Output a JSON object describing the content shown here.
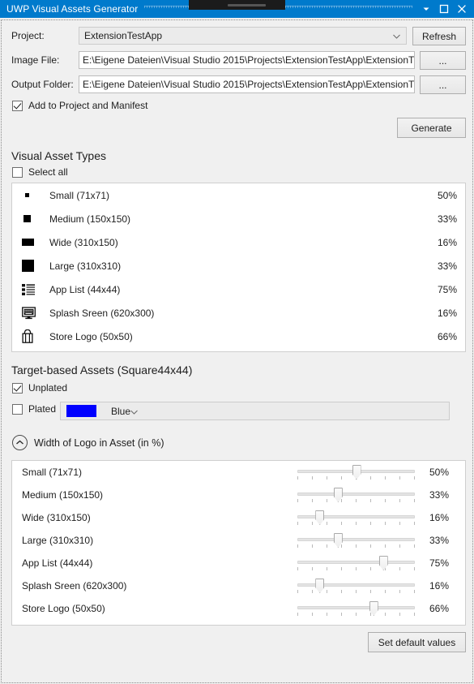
{
  "window": {
    "title": "UWP Visual Assets Generator",
    "titlebar_color": "#007acc",
    "buttons": {
      "dropdown": "window-menu",
      "maximize": "maximize",
      "close": "close"
    }
  },
  "form": {
    "project_label": "Project:",
    "project_value": "ExtensionTestApp",
    "refresh_label": "Refresh",
    "image_file_label": "Image File:",
    "image_file_value": "E:\\Eigene Dateien\\Visual Studio 2015\\Projects\\ExtensionTestApp\\ExtensionT",
    "image_file_browse": "...",
    "output_folder_label": "Output Folder:",
    "output_folder_value": "E:\\Eigene Dateien\\Visual Studio 2015\\Projects\\ExtensionTestApp\\ExtensionT",
    "output_folder_browse": "...",
    "add_to_project_label": "Add to Project and Manifest",
    "add_to_project_checked": true,
    "generate_label": "Generate"
  },
  "asset_types": {
    "title": "Visual Asset Types",
    "select_all_label": "Select all",
    "select_all_checked": false,
    "rows": [
      {
        "icon": "small-tile-icon",
        "name": "Small (71x71)",
        "percent": "50%"
      },
      {
        "icon": "medium-tile-icon",
        "name": "Medium (150x150)",
        "percent": "33%"
      },
      {
        "icon": "wide-tile-icon",
        "name": "Wide (310x150)",
        "percent": "16%"
      },
      {
        "icon": "large-tile-icon",
        "name": "Large (310x310)",
        "percent": "33%"
      },
      {
        "icon": "app-list-icon",
        "name": "App List (44x44)",
        "percent": "75%"
      },
      {
        "icon": "splash-screen-icon",
        "name": "Splash Sreen (620x300)",
        "percent": "16%"
      },
      {
        "icon": "store-logo-icon",
        "name": "Store Logo (50x50)",
        "percent": "66%"
      }
    ]
  },
  "target_based": {
    "title": "Target-based Assets (Square44x44)",
    "unplated_label": "Unplated",
    "unplated_checked": true,
    "plated_label": "Plated",
    "plated_checked": false,
    "color_name": "Blue",
    "color_hex": "#0000FF"
  },
  "width_expander": {
    "title": "Width of Logo in Asset (in %)",
    "expanded": true,
    "rows": [
      {
        "name": "Small (71x71)",
        "percent": "50%",
        "value": 50
      },
      {
        "name": "Medium (150x150)",
        "percent": "33%",
        "value": 33
      },
      {
        "name": "Wide (310x150)",
        "percent": "16%",
        "value": 16
      },
      {
        "name": "Large (310x310)",
        "percent": "33%",
        "value": 33
      },
      {
        "name": "App List (44x44)",
        "percent": "75%",
        "value": 75
      },
      {
        "name": "Splash Sreen (620x300)",
        "percent": "16%",
        "value": 16
      },
      {
        "name": "Store Logo (50x50)",
        "percent": "66%",
        "value": 66
      }
    ],
    "set_defaults_label": "Set default values"
  }
}
